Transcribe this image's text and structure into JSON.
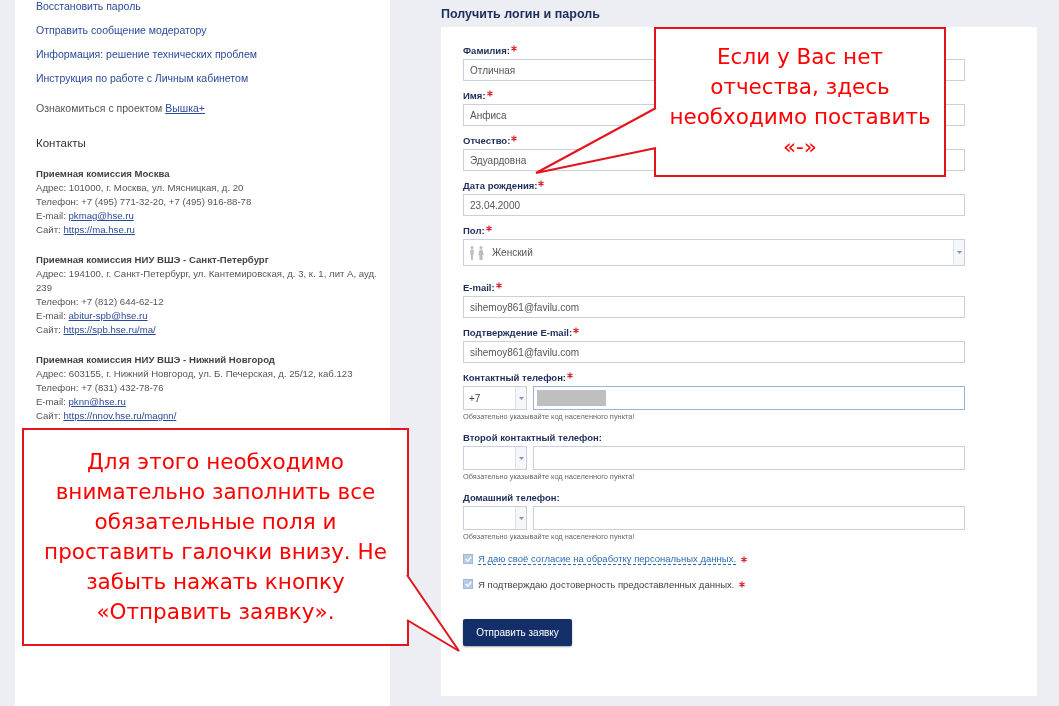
{
  "sidebar": {
    "links": [
      "Восстановить пароль",
      "Отправить сообщение модератору",
      "Информация: решение технических проблем",
      "Инструкция по работе с Личным кабинетом"
    ],
    "project": {
      "text": "Ознакомиться с проектом",
      "link": "Вышка+"
    },
    "contacts_title": "Контакты",
    "contacts": [
      {
        "title": "Приемная комиссия Москва",
        "lines": [
          {
            "kind": "text",
            "text": "Адрес: 101000, г. Москва, ул. Мясницкая, д. 20"
          },
          {
            "kind": "text",
            "text": "Телефон: +7 (495) 771-32-20, +7 (495) 916-88-78"
          },
          {
            "kind": "link",
            "label": "E-mail:",
            "link": "pkmag@hse.ru"
          },
          {
            "kind": "link",
            "label": "Сайт:",
            "link": "https://ma.hse.ru"
          }
        ]
      },
      {
        "title": "Приемная комиссия НИУ ВШЭ - Санкт-Петербург",
        "lines": [
          {
            "kind": "text",
            "text": "Адрес: 194100, г. Санкт-Петербург, ул. Кантемировская, д. 3, к. 1, лит А, ауд. 239"
          },
          {
            "kind": "text",
            "text": "Телефон: +7 (812) 644-62-12"
          },
          {
            "kind": "link",
            "label": "E-mail:",
            "link": "abitur-spb@hse.ru"
          },
          {
            "kind": "link",
            "label": "Сайт:",
            "link": "https://spb.hse.ru/ma/"
          }
        ]
      },
      {
        "title": "Приемная комиссия НИУ ВШЭ - Нижний Новгород",
        "lines": [
          {
            "kind": "text",
            "text": "Адрес: 603155, г. Нижний Новгород, ул. Б. Печерская, д. 25/12, каб.123"
          },
          {
            "kind": "text",
            "text": "Телефон: +7 (831) 432-78-76"
          },
          {
            "kind": "link",
            "label": "E-mail:",
            "link": "pknn@hse.ru"
          },
          {
            "kind": "link",
            "label": "Сайт:",
            "link": "https://nnov.hse.ru/magnn/"
          }
        ]
      }
    ]
  },
  "form": {
    "title": "Получить логин и пароль",
    "fields": [
      {
        "kind": "text",
        "label": "Фамилия:",
        "required": true,
        "value": "Отличная"
      },
      {
        "kind": "text",
        "label": "Имя:",
        "required": true,
        "value": "Анфиса"
      },
      {
        "kind": "text",
        "label": "Отчество:",
        "required": true,
        "value": "Эдуардовна"
      },
      {
        "kind": "text",
        "label": "Дата рождения:",
        "required": true,
        "value": "23.04.2000"
      },
      {
        "kind": "gender_select",
        "label": "Пол:",
        "required": true,
        "value": "Женский"
      },
      {
        "kind": "text",
        "label": "E-mail:",
        "required": true,
        "value": "sihemoy861@favilu.com"
      },
      {
        "kind": "text",
        "label": "Подтверждение E-mail:",
        "required": true,
        "value": "sihemoy861@favilu.com"
      },
      {
        "kind": "phone",
        "label": "Контактный телефон:",
        "required": true,
        "code": "+7",
        "number_hidden": true,
        "focused": true,
        "hint": "Обязательно указывайте код населенного пункта!"
      },
      {
        "kind": "phone",
        "label": "Второй контактный телефон:",
        "required": false,
        "number_hidden": false,
        "focused": false,
        "hint": "Обязательно указывайте код населенного пункта!"
      },
      {
        "kind": "phone",
        "label": "Домашний телефон:",
        "required": false,
        "number_hidden": false,
        "focused": false,
        "hint": "Обязательно указывайте код населенного пункта!"
      }
    ],
    "agreements": [
      {
        "kind": "link",
        "label": "Я даю своё согласие на обработку персональных данных.",
        "checked": true,
        "required": true
      },
      {
        "kind": "text",
        "label": "Я подтверждаю достоверность предоставленных данных.",
        "checked": true,
        "required": true
      }
    ],
    "submit": "Отправить заявку"
  },
  "annotations": [
    {
      "text": "Если у Вас нет\nотчества, здесь\nнеобходимо поставить\n«-»"
    },
    {
      "text": "Для этого необходимо\nвнимательно заполнить все\nобязательные поля и\nпроставить галочки внизу. Не\nзабыть нажать кнопку\n«Отправить заявку»."
    }
  ]
}
